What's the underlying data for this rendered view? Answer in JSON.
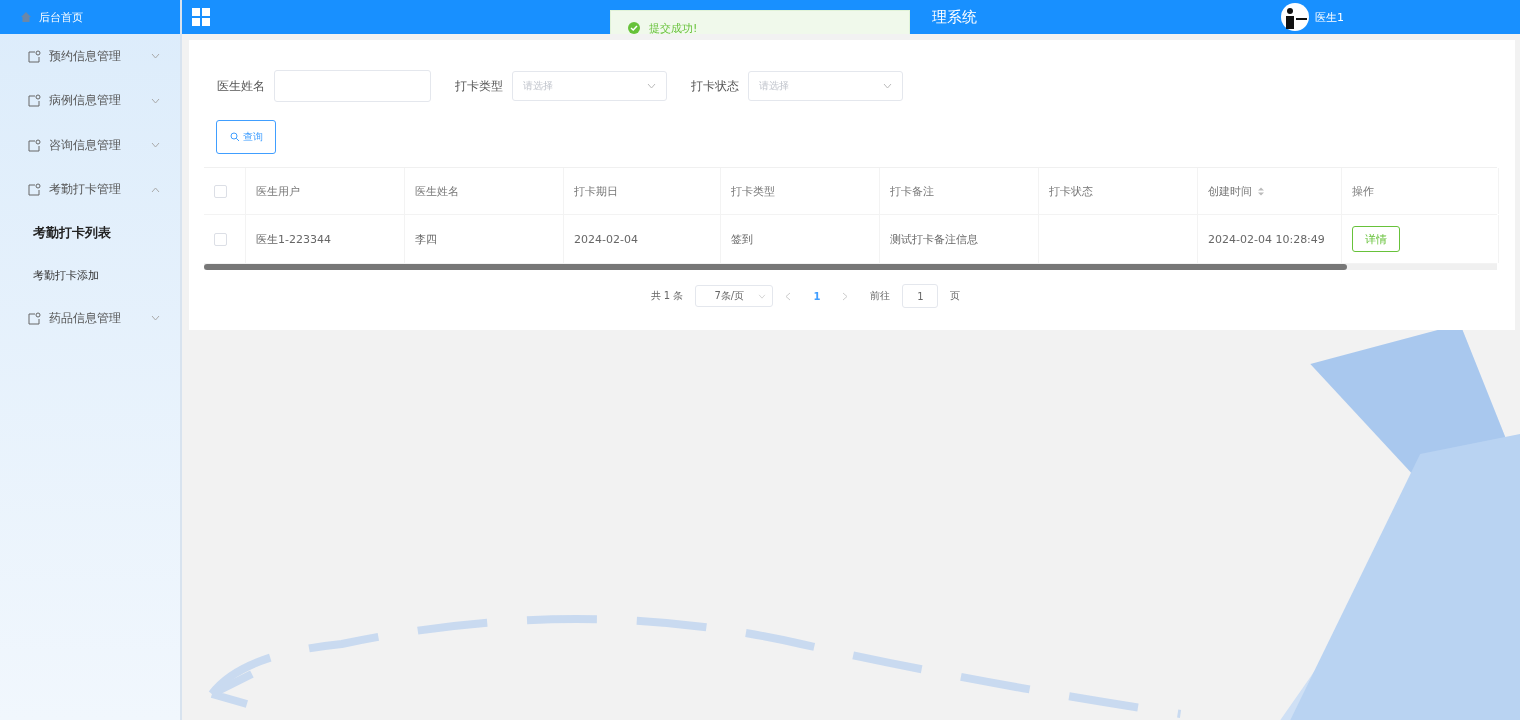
{
  "sidebar": {
    "home": {
      "label": "后台首页"
    },
    "items": [
      {
        "label": "预约信息管理",
        "expanded": false
      },
      {
        "label": "病例信息管理",
        "expanded": false
      },
      {
        "label": "咨询信息管理",
        "expanded": false
      },
      {
        "label": "考勤打卡管理",
        "expanded": true,
        "children": [
          {
            "label": "考勤打卡列表",
            "selected": true
          },
          {
            "label": "考勤打卡添加",
            "selected": false
          }
        ]
      },
      {
        "label": "药品信息管理",
        "expanded": false
      }
    ]
  },
  "header": {
    "title": "理系统",
    "user": "医生1"
  },
  "toast": {
    "message": "提交成功!",
    "kind": "success"
  },
  "filters": [
    {
      "label": "医生姓名",
      "kind": "input"
    },
    {
      "label": "打卡类型",
      "kind": "select",
      "placeholder": "请选择"
    },
    {
      "label": "打卡状态",
      "kind": "select",
      "placeholder": "请选择"
    }
  ],
  "search_button": "查询",
  "table": {
    "header_checked": false,
    "columns": [
      {
        "label": "医生用户",
        "sortable": false
      },
      {
        "label": "医生姓名",
        "sortable": false
      },
      {
        "label": "打卡期日",
        "sortable": false
      },
      {
        "label": "打卡类型",
        "sortable": false
      },
      {
        "label": "打卡备注",
        "sortable": false
      },
      {
        "label": "打卡状态",
        "sortable": false
      },
      {
        "label": "创建时间",
        "sortable": true
      },
      {
        "label": "操作",
        "sortable": false
      }
    ],
    "rows": [
      {
        "checked": false,
        "cells": [
          "医生1-223344",
          "李四",
          "2024-02-04",
          "签到",
          "测试打卡备注信息",
          "",
          "2024-02-04 10:28:49"
        ],
        "action": "详情"
      }
    ]
  },
  "pagination": {
    "total": "共 1 条",
    "page_size": "7条/页",
    "pages": [
      {
        "label": "1",
        "selected": true
      }
    ],
    "goto": "前往",
    "goto_value": "1",
    "page_unit": "页"
  }
}
